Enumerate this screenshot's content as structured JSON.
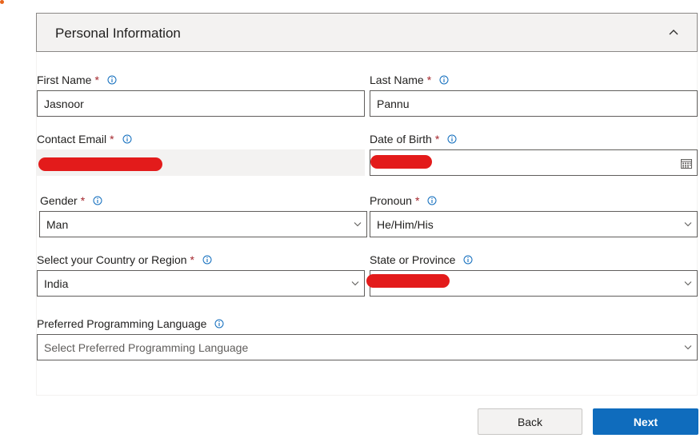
{
  "section": {
    "title": "Personal Information"
  },
  "fields": {
    "first_name": {
      "label": "First Name",
      "required": "*",
      "value": "Jasnoor"
    },
    "last_name": {
      "label": "Last Name",
      "required": "*",
      "value": "Pannu"
    },
    "contact_email": {
      "label": "Contact Email",
      "required": "*",
      "value": ""
    },
    "date_of_birth": {
      "label": "Date of Birth",
      "required": "*",
      "value": ""
    },
    "gender": {
      "label": "Gender",
      "required": "*",
      "value": "Man"
    },
    "pronoun": {
      "label": "Pronoun",
      "required": "*",
      "value": "He/Him/His"
    },
    "country": {
      "label": "Select your Country or Region",
      "required": "*",
      "value": "India"
    },
    "state": {
      "label": "State or Province",
      "value": ""
    },
    "language": {
      "label": "Preferred Programming Language",
      "placeholder": "Select Preferred Programming Language"
    }
  },
  "buttons": {
    "back": "Back",
    "next": "Next"
  },
  "colors": {
    "required": "#a4262c",
    "primary": "#0f6cbd",
    "redaction": "#e31b1b",
    "info": "#0f6cbd"
  },
  "icons": [
    "chevron-up-icon",
    "info-icon",
    "chevron-down-icon",
    "calendar-icon"
  ]
}
